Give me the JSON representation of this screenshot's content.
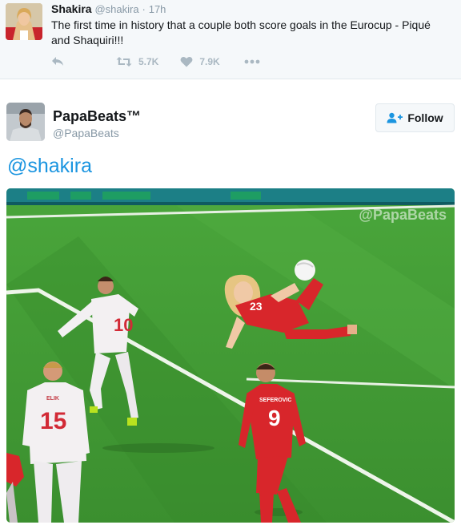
{
  "quoted_tweet": {
    "name": "Shakira",
    "handle": "@shakira",
    "separator": "·",
    "time": "17h",
    "text": "The first time in history that a couple both score goals in the Eurocup - Piqué and Shaquiri!!!",
    "actions": {
      "reply_icon": "reply-icon",
      "retweet_icon": "retweet-icon",
      "retweet_count": "5.7K",
      "like_icon": "heart-icon",
      "like_count": "7.9K",
      "more_icon": "more-icon"
    }
  },
  "main_tweet": {
    "name": "PapaBeats™",
    "handle": "@PapaBeats",
    "follow_label": "Follow",
    "follow_icon": "add-user-icon",
    "text": "@shakira",
    "media": {
      "watermark": "@PapaBeats",
      "jersey_numbers": [
        "10",
        "15",
        "9",
        "23"
      ],
      "jersey_names": [
        "SEFEROVIC",
        "ELIK"
      ]
    }
  },
  "colors": {
    "link_blue": "#1b95e0",
    "muted_gray": "#8899a6",
    "icon_gray": "#aab8c2",
    "pitch_green": "#3f9a35",
    "kit_red": "#d8262b"
  }
}
